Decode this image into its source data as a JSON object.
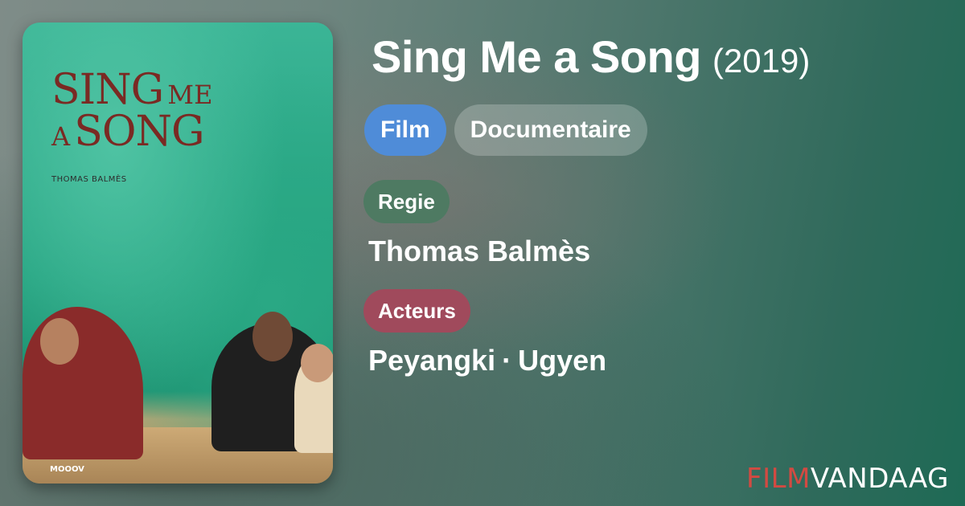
{
  "poster": {
    "title_line1_big": "SING",
    "title_line1_small": "ME",
    "title_line2_small": "A",
    "title_line2_big": "SONG",
    "director": "THOMAS BALMÈS",
    "logo": "MOOOV"
  },
  "movie": {
    "title": "Sing Me a Song",
    "year": "(2019)",
    "chips": [
      "Film",
      "Documentaire"
    ],
    "regie_label": "Regie",
    "regie_value": "Thomas Balmès",
    "acteurs_label": "Acteurs",
    "actors": [
      "Peyangki",
      "Ugyen"
    ],
    "actor_separator": "·"
  },
  "brand": {
    "part1": "FILM",
    "part2": "VANDAAG"
  },
  "colors": {
    "film_chip": "#4f8cd8",
    "regie_chip": "#4e7a62",
    "acteurs_chip": "#a04a5c",
    "brand_accent": "#d24a42"
  }
}
